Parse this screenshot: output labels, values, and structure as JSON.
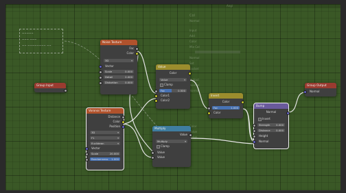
{
  "colors": {
    "background_grid": "#3a5826",
    "link_wire": "#e6e6e6",
    "header_texture": "#b0522c",
    "header_converter": "#3f7da0",
    "header_input": "#9b8d2d",
    "header_vector": "#6a5a9c",
    "header_group": "#9a3b30",
    "socket_float": "#a1a1a1",
    "socket_color": "#c7c729",
    "socket_vector": "#6363c7"
  },
  "topbar": {
    "label": "Angl"
  },
  "frame": {
    "lines": [
      "~~~~~",
      "~~~ ~~~",
      "~~ ~~~~~~~~ ~~"
    ]
  },
  "ghost_panel": {
    "lines": [
      "Col",
      "Normal",
      "Input",
      "Add",
      "Color",
      "Mix Col",
      "Normal",
      "Set",
      "Socket",
      "",
      "Output",
      "Normal",
      "Normal",
      "",
      "Color",
      "Value",
      "Value",
      "Normal",
      "Normal",
      "Value",
      "Float"
    ]
  },
  "group_input": {
    "title": "Group Input"
  },
  "group_output": {
    "title": "Group Output",
    "outputs": [
      "Normal"
    ]
  },
  "noise_texture": {
    "title": "Noise Texture",
    "outputs": [
      "Fac",
      "Color"
    ],
    "dimension": "3D",
    "vector_label": "Vector",
    "fields": [
      {
        "label": "Scale",
        "value": "0.000"
      },
      {
        "label": "Detail",
        "value": "2.000"
      },
      {
        "label": "Distortion",
        "value": "0.000"
      }
    ]
  },
  "voronoi_texture": {
    "title": "Voronoi Texture",
    "outputs": [
      "Distance",
      "Color",
      "Position"
    ],
    "dimension": "3D",
    "feature": "F1",
    "metric": "Euclidean",
    "vector_label": "Vector",
    "scale": {
      "label": "Scale",
      "value": "20.000"
    },
    "randomness": {
      "label": "Randomness",
      "value": "1.000"
    }
  },
  "mix_value": {
    "title": "Value",
    "output": "Color",
    "mode": "Value",
    "clamp": "Clamp",
    "fac": {
      "label": "Fac",
      "value": "0.500"
    },
    "inputs": [
      "Color1",
      "Color2"
    ]
  },
  "invert": {
    "title": "Invert",
    "output": "Color",
    "fac": {
      "label": "Fac",
      "value": "1.000"
    },
    "input": "Color"
  },
  "multiply": {
    "title": "Multiply",
    "output": "Value",
    "operation": "Multiply",
    "clamp": "Clamp",
    "inputs": [
      "Value",
      "Value"
    ]
  },
  "bump": {
    "title": "Bump",
    "output": "Normal",
    "invert": "Invert",
    "fields": [
      {
        "label": "Strength",
        "value": "0.000"
      },
      {
        "label": "Distance",
        "value": "0.000"
      }
    ],
    "inputs": [
      "Height",
      "Normal"
    ]
  }
}
